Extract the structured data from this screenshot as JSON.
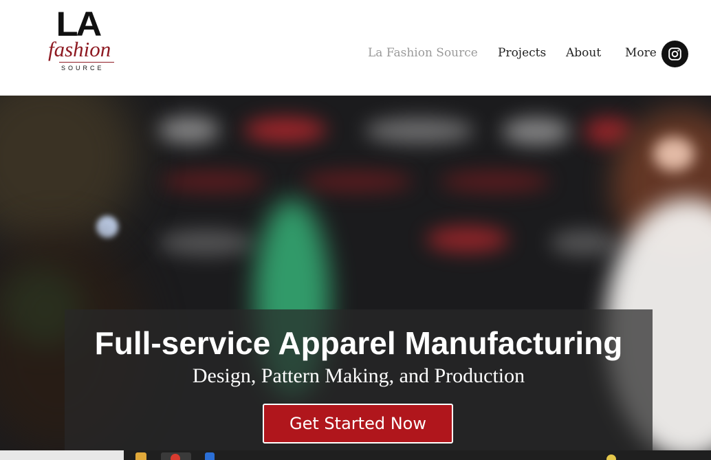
{
  "logo": {
    "line1": "LA",
    "line2": "fashion",
    "line3": "SOURCE"
  },
  "nav": {
    "items": [
      {
        "label": "La Fashion Source",
        "active": true
      },
      {
        "label": "Projects",
        "active": false
      },
      {
        "label": "About",
        "active": false
      },
      {
        "label": "More",
        "active": false
      }
    ]
  },
  "social": {
    "icon": "instagram-icon"
  },
  "hero": {
    "title": "Full-service Apparel Manufacturing",
    "subtitle": "Design, Pattern Making, and Production",
    "cta_label": "Get Started Now"
  },
  "colors": {
    "accent": "#b0161c",
    "logo_red": "#8e1a22",
    "nav_active": "#9a9a9a"
  }
}
